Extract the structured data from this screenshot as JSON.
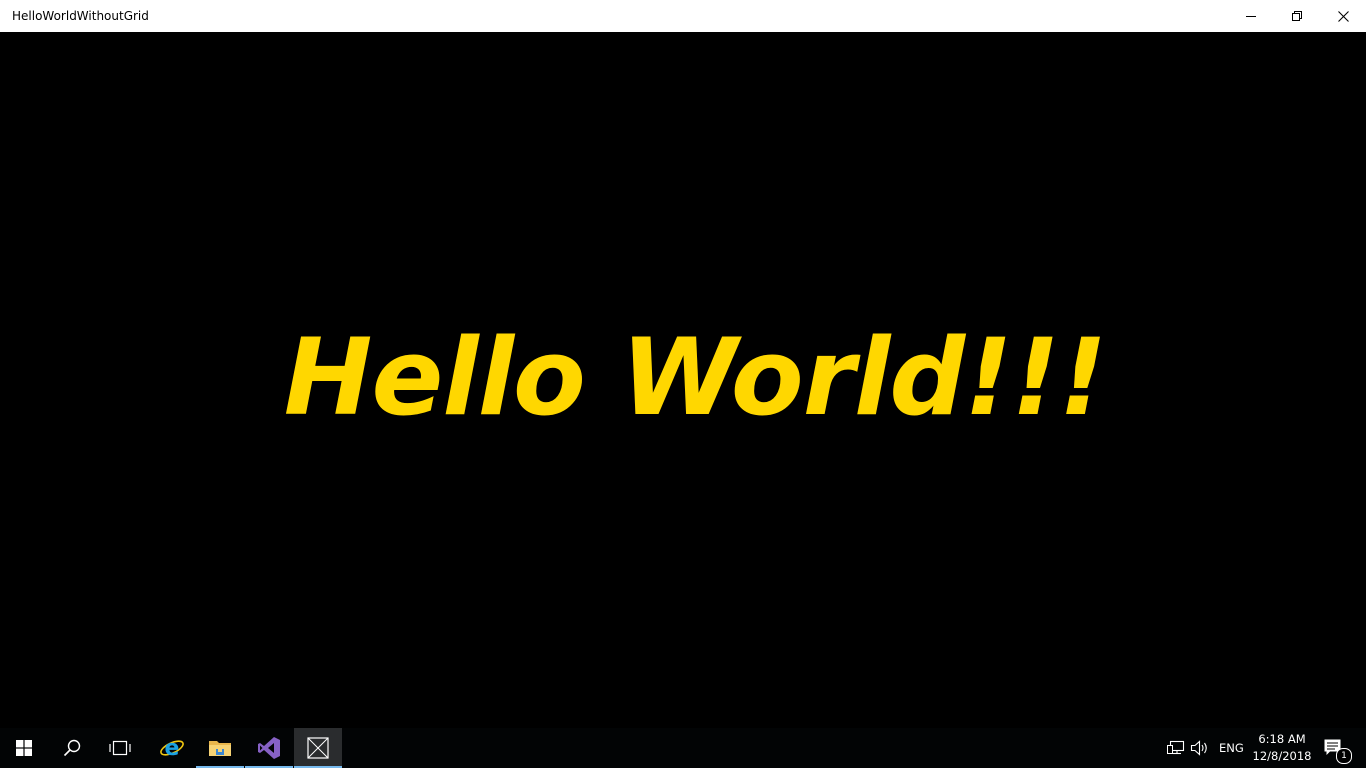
{
  "window": {
    "title": "HelloWorldWithoutGrid",
    "minimize_icon": "minimize-icon",
    "restore_icon": "restore-icon",
    "close_icon": "close-icon"
  },
  "content": {
    "text": "Hello World!!!",
    "text_color": "#FFD700",
    "background": "#000000"
  },
  "taskbar": {
    "start_icon": "windows-start-icon",
    "search_icon": "search-icon",
    "task_view_icon": "task-view-icon",
    "pinned": [
      {
        "name": "internet-explorer-icon",
        "running": false
      },
      {
        "name": "file-explorer-icon",
        "running": true
      },
      {
        "name": "visual-studio-icon",
        "running": true
      },
      {
        "name": "hello-world-app-icon",
        "running": true,
        "active": true
      }
    ],
    "tray": {
      "network_icon": "network-icon",
      "volume_icon": "volume-icon",
      "language": "ENG",
      "time": "6:18 AM",
      "date": "12/8/2018",
      "notifications_icon": "action-center-icon",
      "notifications_count": "1"
    }
  },
  "colors": {
    "accent": "#76B9ED",
    "taskbar": "#020405"
  }
}
